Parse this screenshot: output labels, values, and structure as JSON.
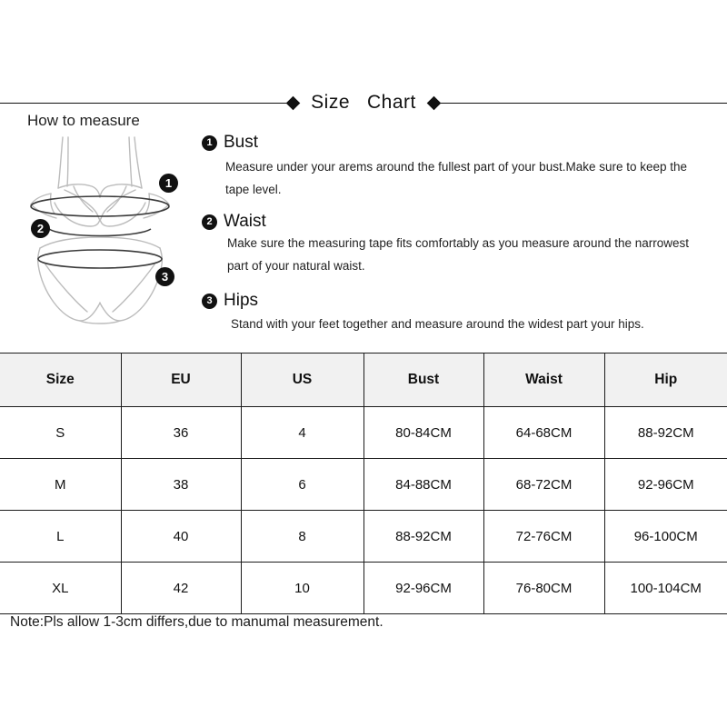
{
  "title": {
    "text": "Size   Chart",
    "left_diamond_icon": "diamond-icon",
    "right_diamond_icon": "diamond-icon"
  },
  "how_to_measure": {
    "label": "How to measure",
    "illustration_alt": "lingerie-measurement-diagram",
    "badges": [
      {
        "number": "1",
        "target": "bust"
      },
      {
        "number": "2",
        "target": "waist"
      },
      {
        "number": "3",
        "target": "hips"
      }
    ]
  },
  "instructions": [
    {
      "number": "1",
      "title": "Bust",
      "body": "Measure under your arems around the fullest part of your bust.Make sure to keep the tape level."
    },
    {
      "number": "2",
      "title": "Waist",
      "body": "Make sure the measuring tape fits comfortably as you measure around the narrowest part of your natural waist."
    },
    {
      "number": "3",
      "title": "Hips",
      "body": "Stand with your feet together and measure around the widest part your hips."
    }
  ],
  "table": {
    "headers": [
      "Size",
      "EU",
      "US",
      "Bust",
      "Waist",
      "Hip"
    ],
    "rows": [
      [
        "S",
        "36",
        "4",
        "80-84CM",
        "64-68CM",
        "88-92CM"
      ],
      [
        "M",
        "38",
        "6",
        "84-88CM",
        "68-72CM",
        "92-96CM"
      ],
      [
        "L",
        "40",
        "8",
        "88-92CM",
        "72-76CM",
        "96-100CM"
      ],
      [
        "XL",
        "42",
        "10",
        "92-96CM",
        "76-80CM",
        "100-104CM"
      ]
    ]
  },
  "footer": {
    "note": "Note:Pls allow 1-3cm differs,due to manumal measurement."
  },
  "colors": {
    "ink": "#111111",
    "header_fill": "#f1f1f1",
    "border": "#1c1c1c",
    "garment_outline": "#b9b9b9",
    "measure_line": "#3b3b3b",
    "background": "#ffffff"
  }
}
